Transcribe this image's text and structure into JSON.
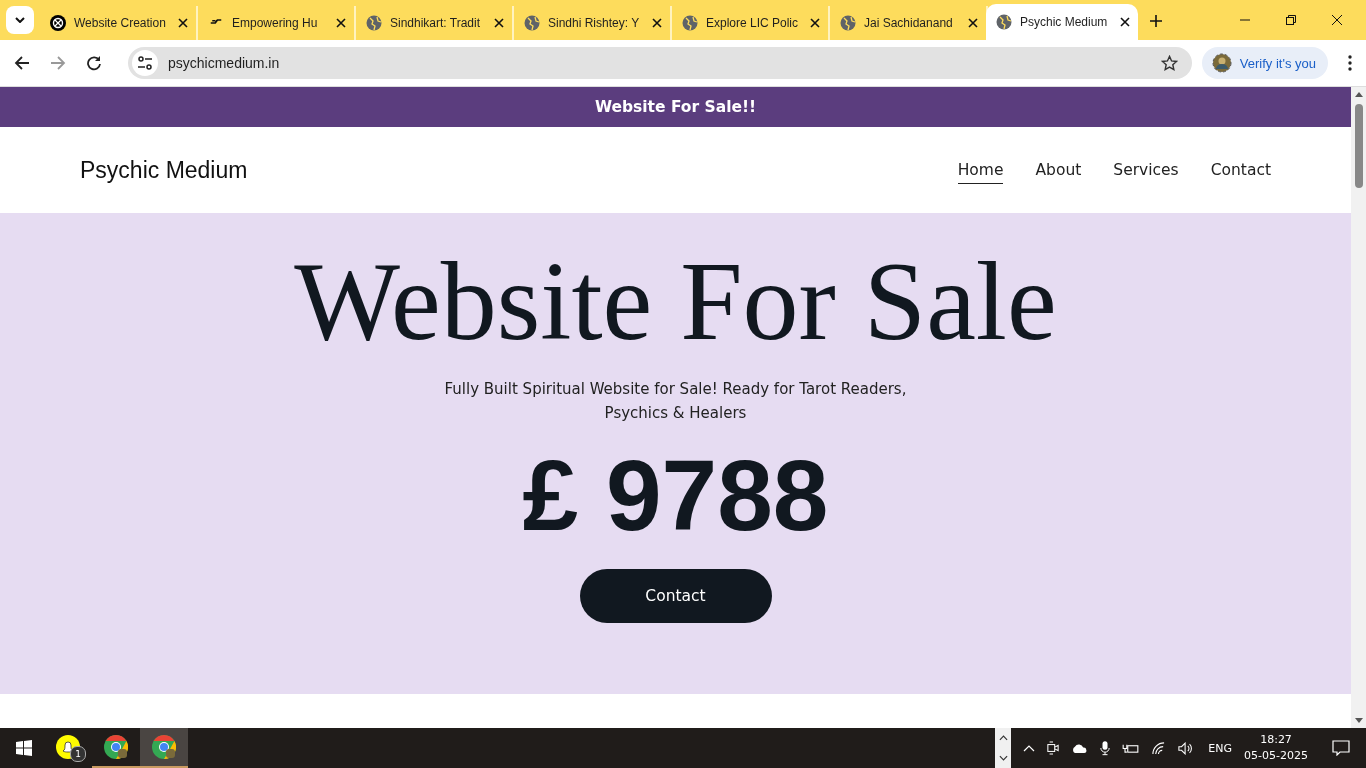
{
  "tabs": [
    {
      "title": "Website Creation",
      "kind": "knot",
      "selected": false
    },
    {
      "title": "Empowering Hu",
      "kind": "dash",
      "selected": false
    },
    {
      "title": "Sindhikart: Tradit",
      "kind": "globe",
      "selected": false
    },
    {
      "title": "Sindhi Rishtey: Y",
      "kind": "globe",
      "selected": false
    },
    {
      "title": "Explore LIC Polic",
      "kind": "globe",
      "selected": false
    },
    {
      "title": "Jai Sachidanand",
      "kind": "globe",
      "selected": false
    },
    {
      "title": "Psychic Medium",
      "kind": "globe",
      "selected": true
    }
  ],
  "address": "psychicmedium.in",
  "profile_button": "Verify it's you",
  "page": {
    "banner": "Website For Sale!!",
    "site_title": "Psychic Medium",
    "nav": [
      {
        "label": "Home",
        "selected": true
      },
      {
        "label": "About",
        "selected": false
      },
      {
        "label": "Services",
        "selected": false
      },
      {
        "label": "Contact",
        "selected": false
      }
    ],
    "hero": {
      "heading": "Website For Sale",
      "subtitle": "Fully Built Spiritual Website for Sale! Ready for Tarot Readers, Psychics & Healers",
      "price": "£ 9788",
      "button": "Contact"
    }
  },
  "taskbar": {
    "apps": [
      {
        "kind": "snapchat",
        "badge": "1",
        "selected": false
      },
      {
        "kind": "chrome",
        "selected": false
      },
      {
        "kind": "chrome",
        "selected": true
      }
    ],
    "language": "ENG",
    "time": "18:27",
    "date": "05-05-2025"
  }
}
